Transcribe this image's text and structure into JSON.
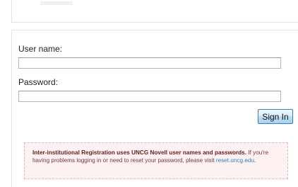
{
  "login": {
    "username_label": "User name:",
    "username_value": "",
    "password_label": "Password:",
    "password_value": "",
    "signin_label": "Sign In"
  },
  "notice": {
    "bold_text": "Inter-institutional Registration uses UNCG Novell user names and passwords.",
    "body_text": " If you're having problems logging in or need to reset your password, please visit ",
    "link_text": "reset.uncg.edu",
    "end_text": "."
  },
  "colors": {
    "notice_background": "#fdf1f1",
    "notice_border": "#e7b4b4",
    "link": "#2f7fc8",
    "button_border": "#3c7fb1"
  }
}
